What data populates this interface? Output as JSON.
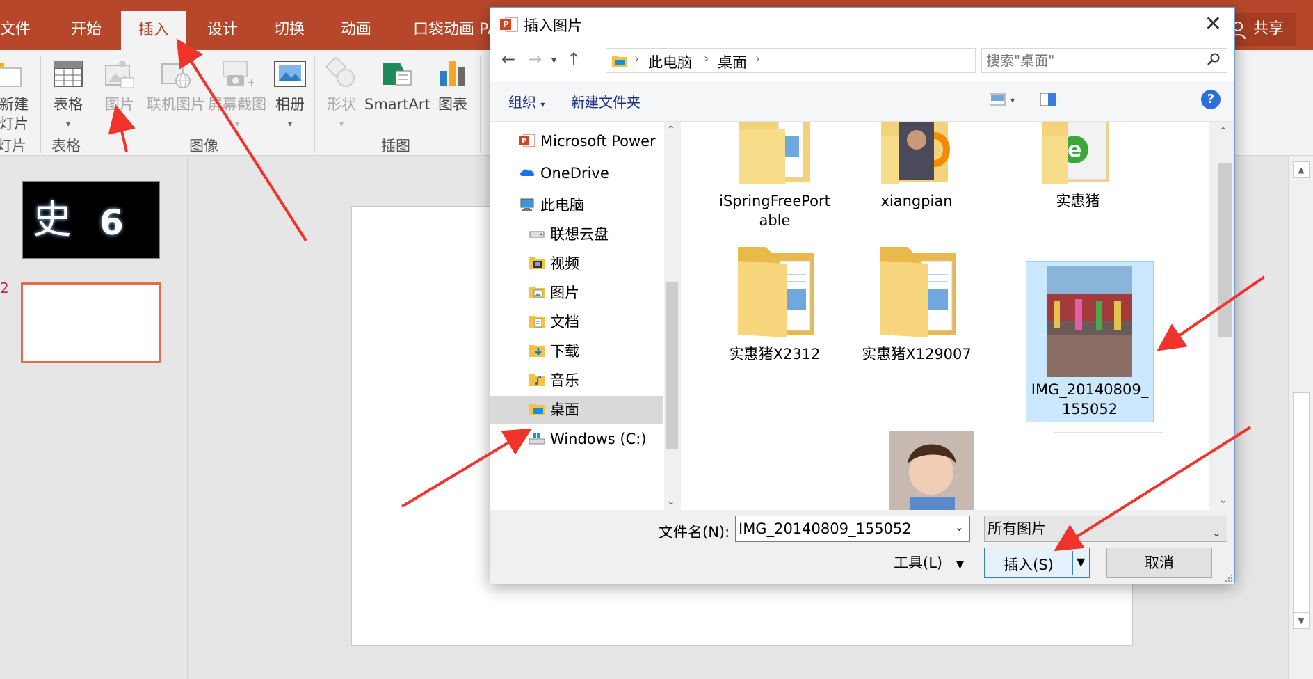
{
  "ribbon": {
    "tabs": [
      "文件",
      "开始",
      "插入",
      "设计",
      "切换",
      "动画",
      "口袋动画 PA"
    ],
    "active_tab": "插入",
    "share_label": "共享",
    "buttons": {
      "new_slide_1": "新建",
      "new_slide_2": "灯片",
      "table": "表格",
      "picture": "图片",
      "online_picture": "联机图片",
      "screenshot": "屏幕截图",
      "album": "相册",
      "shapes": "形状",
      "smartart": "SmartArt",
      "chart": "图表"
    },
    "groups": {
      "slides": "灯片",
      "tables": "表格",
      "images": "图像",
      "illustrations": "插图"
    }
  },
  "slides": {
    "thumb1_char": "史",
    "thumb1_num": "6",
    "thumb2_num": "2"
  },
  "dialog": {
    "title": "插入图片",
    "address": [
      "此电脑",
      "桌面"
    ],
    "search_placeholder": "搜索\"桌面\"",
    "organize": "组织",
    "new_folder": "新建文件夹",
    "help": "?",
    "nav_items": [
      {
        "label": "Microsoft Power",
        "icon": "powerpoint-icon"
      },
      {
        "label": "OneDrive",
        "icon": "onedrive-icon"
      },
      {
        "label": "此电脑",
        "icon": "computer-icon"
      },
      {
        "label": "联想云盘",
        "icon": "drive-icon"
      },
      {
        "label": "视频",
        "icon": "video-folder-icon"
      },
      {
        "label": "图片",
        "icon": "picture-folder-icon"
      },
      {
        "label": "文档",
        "icon": "document-folder-icon"
      },
      {
        "label": "下载",
        "icon": "download-folder-icon"
      },
      {
        "label": "音乐",
        "icon": "music-folder-icon"
      },
      {
        "label": "桌面",
        "icon": "desktop-folder-icon"
      },
      {
        "label": "Windows (C:)",
        "icon": "windows-drive-icon"
      }
    ],
    "selected_nav": "桌面",
    "files": [
      {
        "label1": "iSpringFreePort",
        "label2": "able",
        "kind": "folder"
      },
      {
        "label1": "xiangpian",
        "label2": "",
        "kind": "folder-photo"
      },
      {
        "label1": "实惠猪",
        "label2": "",
        "kind": "folder-ie"
      },
      {
        "label1": "实惠猪X2312",
        "label2": "",
        "kind": "folder"
      },
      {
        "label1": "实惠猪X129007",
        "label2": "",
        "kind": "folder"
      },
      {
        "label1": "IMG_20140809_",
        "label2": "155052",
        "kind": "image",
        "selected": true
      },
      {
        "label1": "",
        "label2": "",
        "kind": "blank"
      },
      {
        "label1": "",
        "label2": "",
        "kind": "portrait"
      },
      {
        "label1": "",
        "label2": "",
        "kind": "white"
      }
    ],
    "filename_label": "文件名(N):",
    "filename_value": "IMG_20140809_155052",
    "filetype": "所有图片",
    "tools": "工具(L)",
    "insert": "插入(S)",
    "cancel": "取消"
  },
  "colors": {
    "ppt_red": "#b7472a",
    "annotation_arrow": "#f0332b",
    "selection_blue": "#cce8ff"
  }
}
